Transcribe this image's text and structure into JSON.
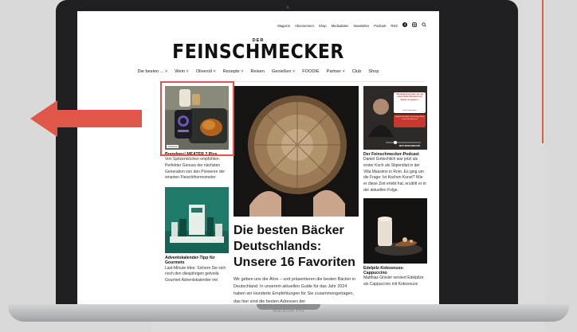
{
  "site": {
    "topnav": [
      "Magazin",
      "Abonnement",
      "Shop",
      "Mediadaten",
      "Newsletter",
      "Podcast",
      "RSS"
    ],
    "logo_small": "DER",
    "logo": "FEINSCHMECKER",
    "mainnav": [
      "Die besten ... ˅",
      "Wein ˅",
      "Olivenöl ˅",
      "Rezepte ˅",
      "Reisen",
      "Genießen ˅",
      "FOODIE",
      "Partner ˅",
      "Club",
      "Shop"
    ]
  },
  "left_col": {
    "ad_tag": "ANZEIGE",
    "article1_title": "Brandneu! MEATER 2 Plus",
    "article1_text": "Von Spitzenköchen empfohlen: Perfekter Genuss der nächsten Generation von den Pionieren der smarten Fleischthermometer.",
    "article2_title": "Adventskalender-Tipp für Gourmets",
    "article2_text": "Last-Minute-Idee: Sichern Sie sich noch den diesjährigen getvoila Gourmet Adventskalender mit"
  },
  "mid_col": {
    "headline": "Die besten Bäcker Deutschlands: Unsere 16 Favoriten",
    "teaser": "Wir geben uns die Ähre – und präsentieren die besten Bäcker in Deutschland. In unserem aktuellen Guide für das Jahr 2024 haben wir Hunderte Empfehlungen für Sie zusammengetragen, das hier sind die besten Adressen der"
  },
  "right_col": {
    "podcast_quote": "\"Rosthaand ist mehr als nur einen teilen Steinbutt mit Kaviar zu tuppen.\"",
    "podcast_name": "Daniel Gottschlich",
    "podcast_sub": "Daniel Gottschlich ist ein junger Koch in der Villa Massimo",
    "podcast_brand": "DER FEINSCHMECKER",
    "article1_title": "Der Feinschmecker-Podcast",
    "article1_text": "Daniel Gottschlich war jetzt als erster Koch als Stipendiat in der Villa Massimo in Rom. Es ging um die Frage: Ist Kochen Kunst? Wie er diese Zeit erlebt hat, erzählt er in der aktuellen Folge.",
    "article2_title": "Edelpilz-Kokosnuss-Cappuccino",
    "article2_text": "Matthias Ghisler serviert Edelpilze als Cappuccino mit Kokosnuss"
  },
  "laptop_label": "MacBook Pro",
  "colors": {
    "accent": "#e0574a",
    "screen_bg": "#ffffff",
    "bezel": "#1f1f21"
  }
}
